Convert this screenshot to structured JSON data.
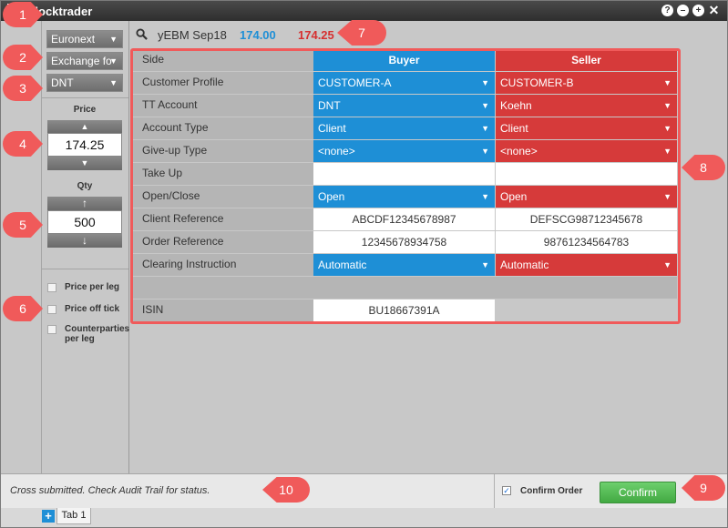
{
  "window": {
    "title": "Blocktrader"
  },
  "left": {
    "exchange": "Euronext",
    "order_type": "Exchange fo",
    "account": "DNT",
    "price_label": "Price",
    "price_value": "174.25",
    "qty_label": "Qty",
    "qty_value": "500",
    "price_per_leg": "Price per leg",
    "price_off_tick": "Price off tick",
    "counterparties_per_leg": "Counterparties per leg"
  },
  "topbar": {
    "instrument": "yEBM Sep18",
    "bid": "174.00",
    "ask": "174.25"
  },
  "grid": {
    "side_label": "Side",
    "buyer": "Buyer",
    "seller": "Seller",
    "rows": [
      {
        "label": "Customer Profile",
        "buyer": "CUSTOMER-A",
        "seller": "CUSTOMER-B"
      },
      {
        "label": "TT Account",
        "buyer": "DNT",
        "seller": "Koehn"
      },
      {
        "label": "Account Type",
        "buyer": "Client",
        "seller": "Client"
      },
      {
        "label": "Give-up Type",
        "buyer": "<none>",
        "seller": "<none>"
      },
      {
        "label": "Take Up",
        "buyer": "",
        "seller": ""
      },
      {
        "label": "Open/Close",
        "buyer": "Open",
        "seller": "Open"
      },
      {
        "label": "Client Reference",
        "buyer": "ABCDF12345678987",
        "seller": "DEFSCG98712345678"
      },
      {
        "label": "Order Reference",
        "buyer": "12345678934758",
        "seller": "98761234564783"
      },
      {
        "label": "Clearing Instruction",
        "buyer": "Automatic",
        "seller": "Automatic"
      }
    ],
    "isin_label": "ISIN",
    "isin_value": "BU18667391A"
  },
  "status": {
    "message": "Cross submitted. Check Audit Trail for status.",
    "confirm_order_label": "Confirm Order",
    "confirm_button": "Confirm"
  },
  "tabs": {
    "plus": "+",
    "tab1": "Tab 1"
  },
  "callouts": {
    "c1": "1",
    "c2": "2",
    "c3": "3",
    "c4": "4",
    "c5": "5",
    "c6": "6",
    "c7": "7",
    "c8": "8",
    "c9": "9",
    "c10": "10"
  },
  "icons": {
    "caret": "▼",
    "step_up": "▲",
    "step_down": "▼",
    "arrow_up": "↑",
    "arrow_down": "↓",
    "check": "✓"
  },
  "colors": {
    "buyer": "#1e8fd6",
    "seller": "#d63a3a",
    "callout": "#f05a5a",
    "confirm": "#42a942"
  }
}
